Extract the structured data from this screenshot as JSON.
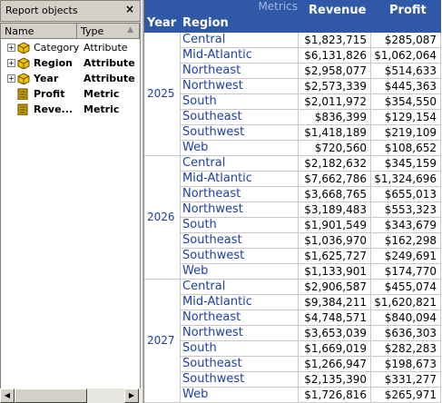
{
  "panel": {
    "title": "Report objects",
    "close_glyph": "×",
    "col_name": "Name",
    "col_type": "Type",
    "sort_glyph": "▲",
    "items": [
      {
        "name": "Category",
        "type": "Attribute",
        "bold": false,
        "icon": "attribute-icon"
      },
      {
        "name": "Region",
        "type": "Attribute",
        "bold": true,
        "icon": "attribute-icon"
      },
      {
        "name": "Year",
        "type": "Attribute",
        "bold": true,
        "icon": "attribute-icon"
      },
      {
        "name": "Profit",
        "type": "Metric",
        "bold": true,
        "icon": "metric-icon"
      },
      {
        "name": "Reve...",
        "type": "Metric",
        "bold": true,
        "icon": "metric-icon"
      }
    ],
    "scroll_left": "◀",
    "scroll_right": "▶"
  },
  "grid": {
    "metrics_label": "Metrics",
    "headers": {
      "year": "Year",
      "region": "Region",
      "revenue": "Revenue",
      "profit": "Profit"
    },
    "groups": [
      {
        "year": "2025",
        "rows": [
          {
            "region": "Central",
            "revenue": "$1,823,715",
            "profit": "$285,087"
          },
          {
            "region": "Mid-Atlantic",
            "revenue": "$6,131,826",
            "profit": "$1,062,064"
          },
          {
            "region": "Northeast",
            "revenue": "$2,958,077",
            "profit": "$514,633"
          },
          {
            "region": "Northwest",
            "revenue": "$2,573,339",
            "profit": "$445,363"
          },
          {
            "region": "South",
            "revenue": "$2,011,972",
            "profit": "$354,550"
          },
          {
            "region": "Southeast",
            "revenue": "$836,399",
            "profit": "$129,154"
          },
          {
            "region": "Southwest",
            "revenue": "$1,418,189",
            "profit": "$219,109"
          },
          {
            "region": "Web",
            "revenue": "$720,560",
            "profit": "$108,652"
          }
        ]
      },
      {
        "year": "2026",
        "rows": [
          {
            "region": "Central",
            "revenue": "$2,182,632",
            "profit": "$345,159"
          },
          {
            "region": "Mid-Atlantic",
            "revenue": "$7,662,786",
            "profit": "$1,324,696"
          },
          {
            "region": "Northeast",
            "revenue": "$3,668,765",
            "profit": "$655,013"
          },
          {
            "region": "Northwest",
            "revenue": "$3,189,483",
            "profit": "$553,323"
          },
          {
            "region": "South",
            "revenue": "$1,901,549",
            "profit": "$343,679"
          },
          {
            "region": "Southeast",
            "revenue": "$1,036,970",
            "profit": "$162,298"
          },
          {
            "region": "Southwest",
            "revenue": "$1,625,727",
            "profit": "$249,691"
          },
          {
            "region": "Web",
            "revenue": "$1,133,901",
            "profit": "$174,770"
          }
        ]
      },
      {
        "year": "2027",
        "rows": [
          {
            "region": "Central",
            "revenue": "$2,906,587",
            "profit": "$455,074"
          },
          {
            "region": "Mid-Atlantic",
            "revenue": "$9,384,211",
            "profit": "$1,620,821"
          },
          {
            "region": "Northeast",
            "revenue": "$4,748,571",
            "profit": "$840,094"
          },
          {
            "region": "Northwest",
            "revenue": "$3,653,039",
            "profit": "$636,303"
          },
          {
            "region": "South",
            "revenue": "$1,669,019",
            "profit": "$282,283"
          },
          {
            "region": "Southeast",
            "revenue": "$1,266,947",
            "profit": "$198,673"
          },
          {
            "region": "Southwest",
            "revenue": "$2,135,390",
            "profit": "$331,277"
          },
          {
            "region": "Web",
            "revenue": "$1,726,816",
            "profit": "$265,971"
          }
        ]
      }
    ]
  },
  "colors": {
    "header_bg": "#2f59a6",
    "link": "#1c3fa8",
    "attribute_icon": "#f2c200",
    "metric_icon": "#c9a000"
  }
}
